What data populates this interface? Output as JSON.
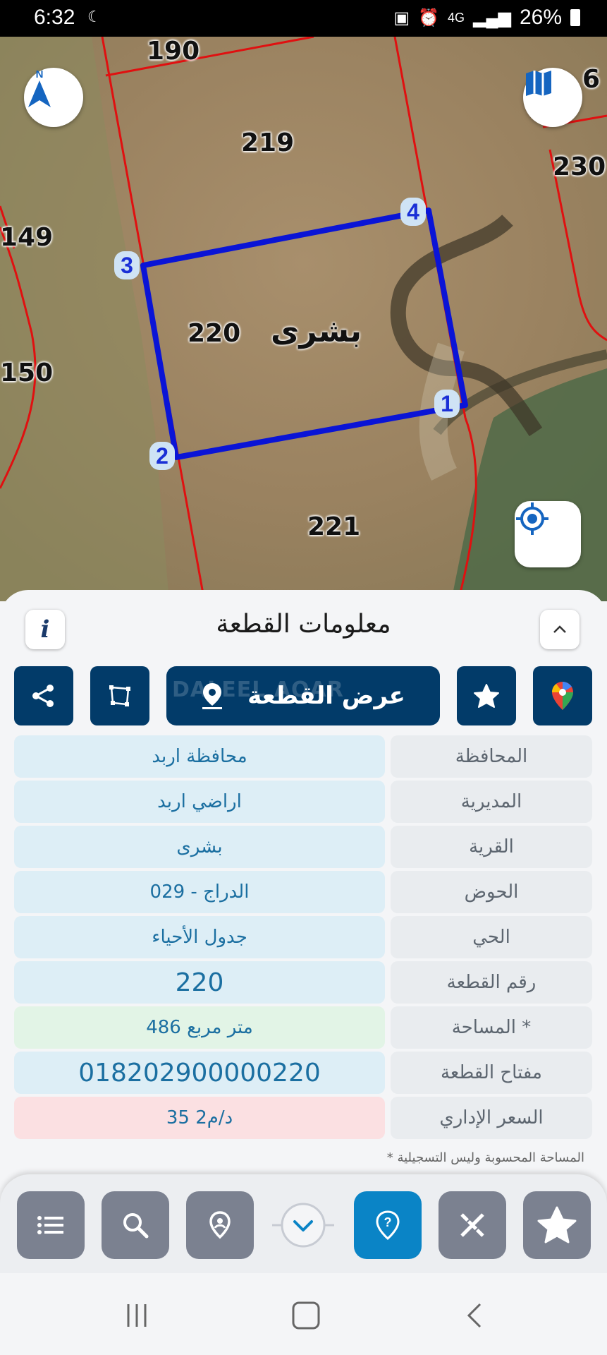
{
  "status_bar": {
    "time": "6:32",
    "network": "4G",
    "battery": "26%"
  },
  "map": {
    "parcel_numbers": [
      "190",
      "219",
      "230",
      "149",
      "150",
      "220",
      "221"
    ],
    "partial_parcel": "6",
    "village_label": "بشرى",
    "corner_points": [
      "1",
      "2",
      "3",
      "4"
    ],
    "north_label": "N",
    "colors": {
      "parcel_outline": "#0a14d6",
      "boundary_lines": "#e01010",
      "map_ground": "#9b8565"
    }
  },
  "sheet": {
    "title": "معلومات القطعة",
    "info_label": "i",
    "view_button_label": "عرض القطعة",
    "view_button_watermark": "DALEEL AQAR"
  },
  "rows": [
    {
      "label": "المحافظة",
      "value": "محافظة اربد",
      "style": "blue"
    },
    {
      "label": "المديرية",
      "value": "اراضي اربد",
      "style": "blue"
    },
    {
      "label": "القرية",
      "value": "بشرى",
      "style": "blue"
    },
    {
      "label": "الحوض",
      "value": "الدراج - 029",
      "style": "blue"
    },
    {
      "label": "الحي",
      "value": "جدول الأحياء",
      "style": "blue"
    },
    {
      "label": "رقم القطعة",
      "value": "220",
      "style": "blue big"
    },
    {
      "label": "المساحة *",
      "value": "486   متر مربع",
      "style": "green"
    },
    {
      "label": "مفتاح القطعة",
      "value": "018202900000220",
      "style": "blue big"
    },
    {
      "label": "السعر الإداري",
      "value": "35 د/م2",
      "style": "red"
    }
  ],
  "footnote": "* المساحة المحسوبة وليس التسجيلية",
  "colors": {
    "primary": "#023b69",
    "accent": "#0a84c6",
    "grey_button": "#7b8190"
  },
  "bottom_nav": [
    "list-icon",
    "search-icon",
    "location-pin-icon",
    "chevron-down-icon",
    "help-icon",
    "tools-icon",
    "star-icon"
  ]
}
